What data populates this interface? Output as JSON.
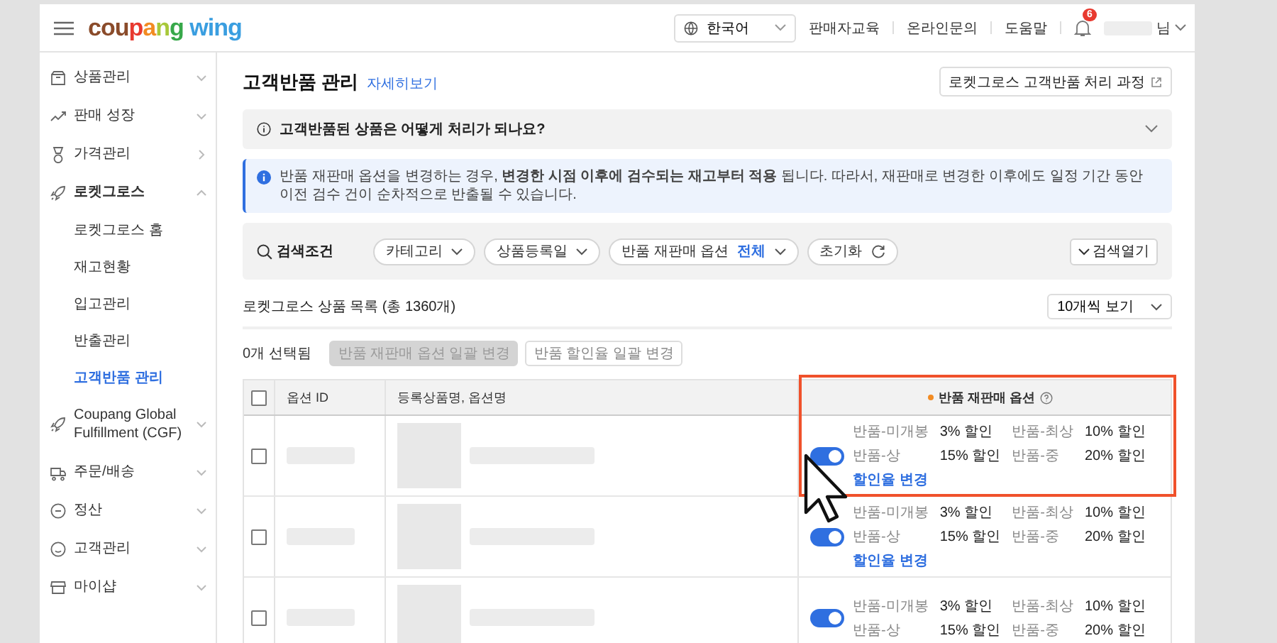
{
  "header": {
    "logo": "coupang wing",
    "language": "한국어",
    "links": [
      "판매자교육",
      "온라인문의",
      "도움말"
    ],
    "notification_count": "6",
    "user_suffix": "님"
  },
  "sidebar": {
    "items": [
      {
        "label": "상품관리",
        "kind": "group",
        "expanded": false
      },
      {
        "label": "판매 성장",
        "kind": "group",
        "expanded": false
      },
      {
        "label": "가격관리",
        "kind": "link",
        "expanded": false
      },
      {
        "label": "로켓그로스",
        "kind": "group",
        "expanded": true,
        "children": [
          {
            "label": "로켓그로스 홈",
            "selected": false
          },
          {
            "label": "재고현황",
            "selected": false
          },
          {
            "label": "입고관리",
            "selected": false
          },
          {
            "label": "반출관리",
            "selected": false
          },
          {
            "label": "고객반품 관리",
            "selected": true
          }
        ]
      },
      {
        "label": "Coupang Global Fulfillment (CGF)",
        "kind": "group",
        "expanded": false
      },
      {
        "label": "주문/배송",
        "kind": "group",
        "expanded": false
      },
      {
        "label": "정산",
        "kind": "group",
        "expanded": false
      },
      {
        "label": "고객관리",
        "kind": "group",
        "expanded": false
      },
      {
        "label": "마이샵",
        "kind": "group",
        "expanded": false
      }
    ]
  },
  "page": {
    "title": "고객반품 관리",
    "detail_link": "자세히보기",
    "process_button": "로켓그로스 고객반품 처리 과정"
  },
  "faq": {
    "question": "고객반품된 상품은 어떻게 처리가 되나요?",
    "expanded": false
  },
  "notice": "반품 재판매 옵션을 변경하는 경우, **변경한 시점 이후에 검수되는 재고부터 적용** 됩니다. 따라서, 재판매로 변경한 이후에도 일정 기간 동안 이전 검수 건이 순차적으로 반출될 수 있습니다.",
  "search": {
    "label": "검색조건",
    "filters": [
      {
        "label": "카테고리"
      },
      {
        "label": "상품등록일"
      },
      {
        "label": "반품 재판매 옵션",
        "value": "전체"
      }
    ],
    "reset": "초기화",
    "open_button": "검색열기"
  },
  "list": {
    "title": "로켓그로스 상품 목록 (총 1360개)",
    "page_size": "10개씩 보기",
    "selected_count": "0개 선택됨",
    "bulk_buttons": [
      {
        "label": "반품 재판매 옵션 일괄 변경",
        "disabled": true
      },
      {
        "label": "반품 할인율 일괄 변경",
        "disabled": false
      }
    ]
  },
  "table": {
    "highlight": true,
    "all_checked": false,
    "columns": [
      {
        "label": "옵션 ID",
        "required": false
      },
      {
        "label": "등록상품명, 옵션명",
        "required": false
      },
      {
        "label": "반품 재판매 옵션",
        "required": true
      }
    ],
    "rows": [
      {
        "checked": false,
        "resale_on": true,
        "discounts": [
          {
            "grade": "반품-미개봉",
            "rate": "3% 할인"
          },
          {
            "grade": "반품-최상",
            "rate": "10% 할인"
          },
          {
            "grade": "반품-상",
            "rate": "15% 할인"
          },
          {
            "grade": "반품-중",
            "rate": "20% 할인"
          }
        ],
        "link": "할인율 변경"
      },
      {
        "checked": false,
        "resale_on": true,
        "discounts": [
          {
            "grade": "반품-미개봉",
            "rate": "3% 할인"
          },
          {
            "grade": "반품-최상",
            "rate": "10% 할인"
          },
          {
            "grade": "반품-상",
            "rate": "15% 할인"
          },
          {
            "grade": "반품-중",
            "rate": "20% 할인"
          }
        ],
        "link": "할인율 변경"
      },
      {
        "checked": false,
        "resale_on": true,
        "discounts": [
          {
            "grade": "반품-미개봉",
            "rate": "3% 할인"
          },
          {
            "grade": "반품-최상",
            "rate": "10% 할인"
          },
          {
            "grade": "반품-상",
            "rate": "15% 할인"
          },
          {
            "grade": "반품-중",
            "rate": "20% 할인"
          }
        ]
      }
    ]
  }
}
